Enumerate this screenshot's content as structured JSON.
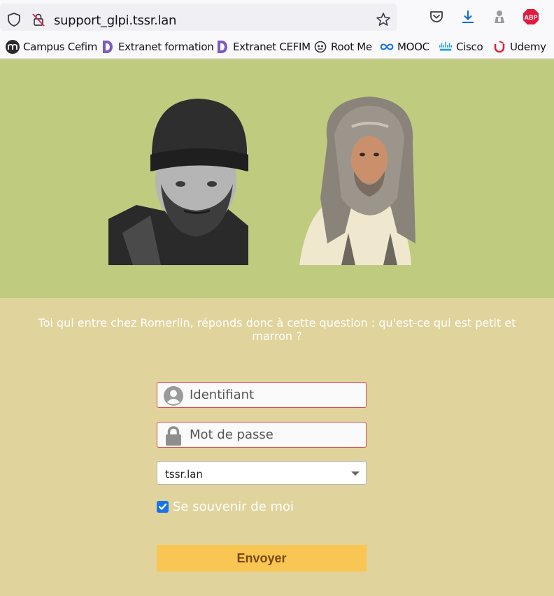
{
  "browser": {
    "url": "support_glpi.tssr.lan",
    "toolbar_icons": [
      "shield-icon",
      "lock-slash-icon",
      "star-icon",
      "pocket-icon",
      "download-icon",
      "extension-icon",
      "adblock-icon"
    ],
    "adblock_label": "ABP",
    "bookmarks": [
      {
        "label": "Campus Cefim",
        "icon": "moodle-icon"
      },
      {
        "label": "Extranet formation",
        "icon": "d-logo-icon"
      },
      {
        "label": "Extranet CEFIM",
        "icon": "d-logo-icon"
      },
      {
        "label": "Root Me",
        "icon": "root-me-icon"
      },
      {
        "label": "MOOC",
        "icon": "infinity-icon"
      },
      {
        "label": "Cisco",
        "icon": "cisco-icon"
      },
      {
        "label": "Udemy",
        "icon": "udemy-icon"
      }
    ]
  },
  "page": {
    "question": "Toi qui entre chez Romerlin, réponds donc à cette question : qu'est-ce qui est petit et marron ?",
    "login": {
      "username_placeholder": "Identifiant",
      "password_placeholder": "Mot de passe",
      "domain_selected": "tssr.lan",
      "remember_label": "Se souvenir de moi",
      "remember_checked": true,
      "submit_label": "Envoyer"
    },
    "colors": {
      "banner": "#bfcb7f",
      "background": "#e0d39c",
      "submit": "#f9c653",
      "field_border": "#e34a4a"
    }
  }
}
